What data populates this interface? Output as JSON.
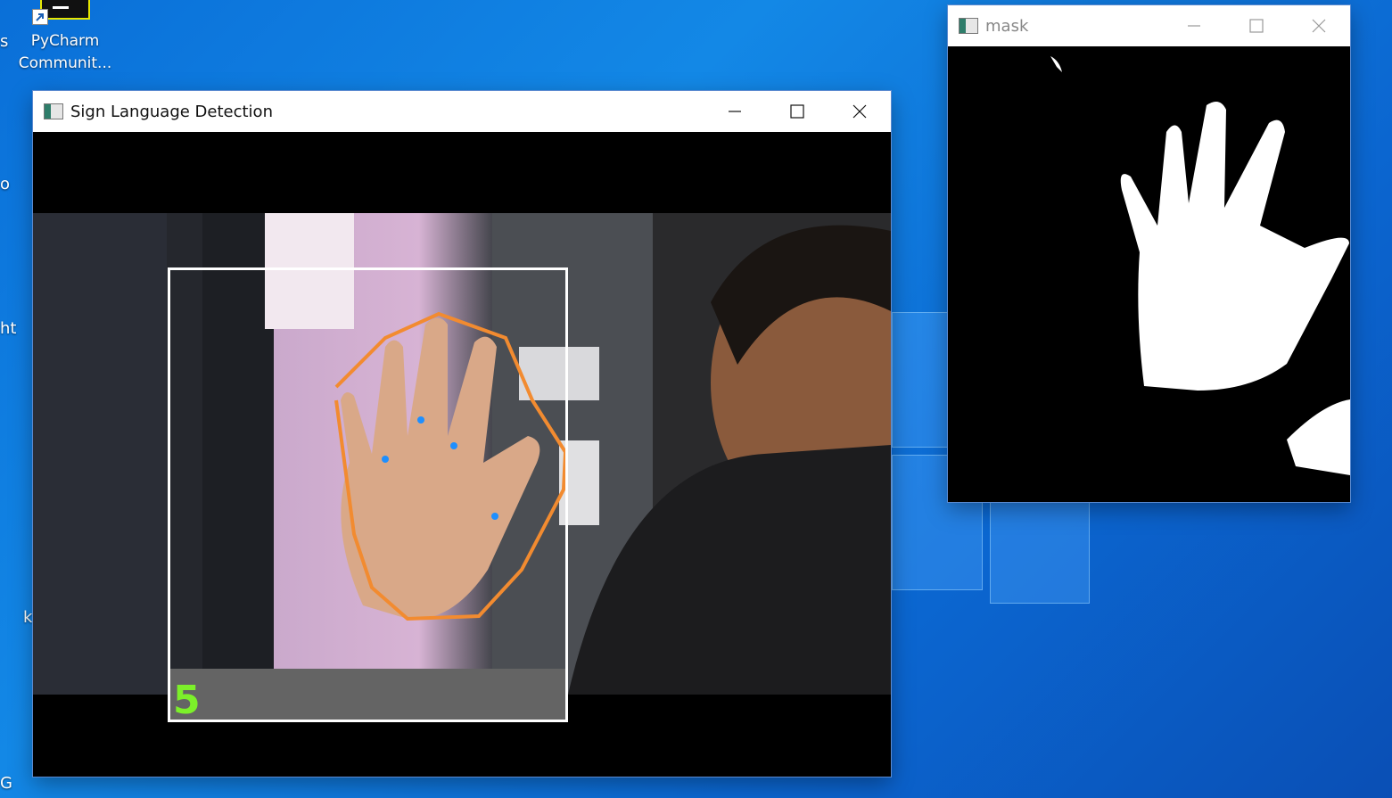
{
  "desktop": {
    "icon_label": "PyCharm Communit...",
    "edge_labels": [
      "s",
      "o",
      "ht",
      "k",
      "G"
    ]
  },
  "main_window": {
    "title": "Sign Language Detection",
    "detected_count": "5"
  },
  "mask_window": {
    "title": "mask"
  },
  "colors": {
    "desktop_blue": "#0a6fd8",
    "contour": "#f28b30",
    "defect_points": "#1e8fff",
    "count_text": "#7cf02a",
    "label_bar": "#646464",
    "roi_box": "#ffffff"
  }
}
